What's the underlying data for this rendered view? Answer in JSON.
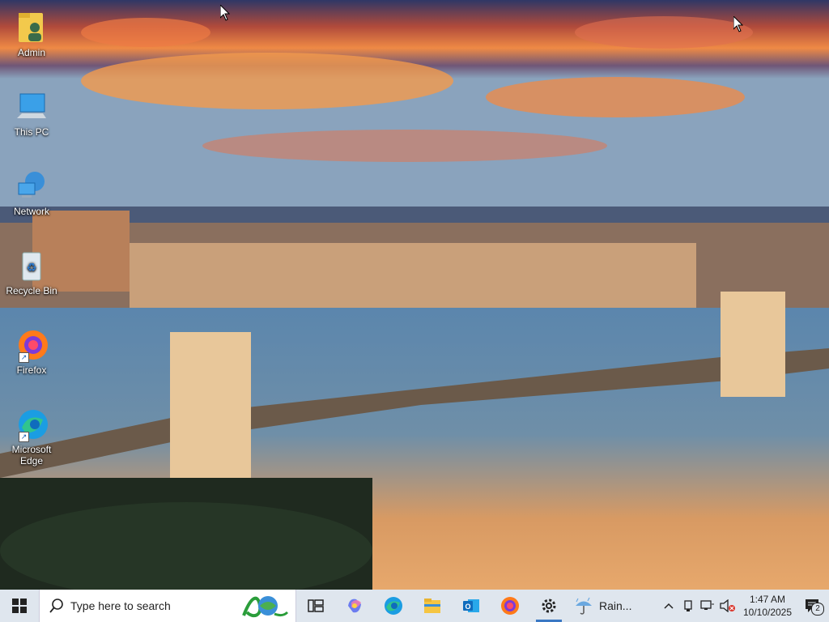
{
  "desktop_icons": [
    {
      "label": "Admin",
      "icon": "user-folder-icon"
    },
    {
      "label": "This PC",
      "icon": "computer-icon"
    },
    {
      "label": "Network",
      "icon": "network-icon"
    },
    {
      "label": "Recycle Bin",
      "icon": "recycle-bin-icon"
    },
    {
      "label": "Firefox",
      "icon": "firefox-icon"
    },
    {
      "label": "Microsoft Edge",
      "icon": "edge-icon"
    }
  ],
  "taskbar": {
    "search_placeholder": "Type here to search",
    "pinned": [
      "task-view-icon",
      "copilot-icon",
      "edge-icon",
      "file-explorer-icon",
      "outlook-icon",
      "firefox-icon",
      "settings-icon"
    ],
    "weather_text": "Rain...",
    "clock": {
      "time": "1:47 AM",
      "date": "10/10/2025"
    },
    "notification_count": "2"
  },
  "colors": {
    "taskbar": "#dfe6ee",
    "accent": "#3a78c4"
  }
}
